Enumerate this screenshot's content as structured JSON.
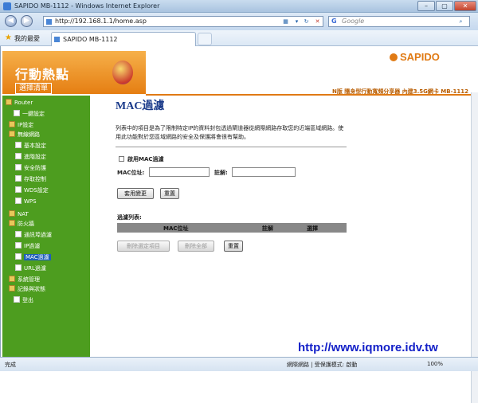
{
  "window": {
    "title": "SAPIDO MB-1112 - Windows Internet Explorer",
    "min": "–",
    "max": "▢",
    "close": "✕"
  },
  "nav": {
    "url": "http://192.168.1.1/home.asp",
    "search_placeholder": "Google",
    "search_logo": "G"
  },
  "favorites": {
    "label": "我的最愛",
    "tab_title": "SAPIDO MB-1112"
  },
  "banner": {
    "logo_text": "行動熱點",
    "menu_label": "選擇清單",
    "brand": "SAPIDO",
    "subtitle": "N版 隨身型行動寬頻分享器 內建3.5G網卡 MB-1112"
  },
  "sidebar": {
    "items": [
      {
        "label": "Router",
        "type": "root"
      },
      {
        "label": "一鍵設定",
        "type": "page"
      },
      {
        "label": "IP設定",
        "type": "folder"
      },
      {
        "label": "無線網路",
        "type": "folder"
      },
      {
        "label": "基本設定",
        "type": "page"
      },
      {
        "label": "進階設定",
        "type": "page"
      },
      {
        "label": "安全防護",
        "type": "page"
      },
      {
        "label": "存取控制",
        "type": "page"
      },
      {
        "label": "WDS設定",
        "type": "page"
      },
      {
        "label": "WPS",
        "type": "page"
      },
      {
        "label": "NAT",
        "type": "folder"
      },
      {
        "label": "防火牆",
        "type": "folder"
      },
      {
        "label": "通訊埠過濾",
        "type": "page"
      },
      {
        "label": "IP過濾",
        "type": "page"
      },
      {
        "label": "MAC過濾",
        "type": "page"
      },
      {
        "label": "URL過濾",
        "type": "page"
      },
      {
        "label": "系統管理",
        "type": "folder"
      },
      {
        "label": "記錄與狀態",
        "type": "folder"
      },
      {
        "label": "登出",
        "type": "page"
      }
    ]
  },
  "main": {
    "title": "MAC過濾",
    "description": "列表中的項目是為了限制特定IP的資料封包透過閘道器從網際網路存取您的近端區域網路。使用此功能對於您區域網路的安全及保護將會很有幫助。",
    "enable_label": "啟用MAC過濾",
    "mac_label": "MAC位址:",
    "mac_value": "",
    "comment_label": "註解:",
    "comment_value": "",
    "apply_button": "套用變更",
    "reset_button": "重置",
    "filter_list_title": "過濾列表:",
    "columns": [
      "MAC位址",
      "註解",
      "選擇"
    ],
    "delete_selected": "刪除選定項目",
    "delete_all": "刪除全部",
    "reset_button2": "重置"
  },
  "watermark": "http://www.iqmore.idv.tw",
  "status": {
    "left": "完成",
    "zone": "網際網路 | 受保護模式: 啟動",
    "zoom": "100%"
  }
}
